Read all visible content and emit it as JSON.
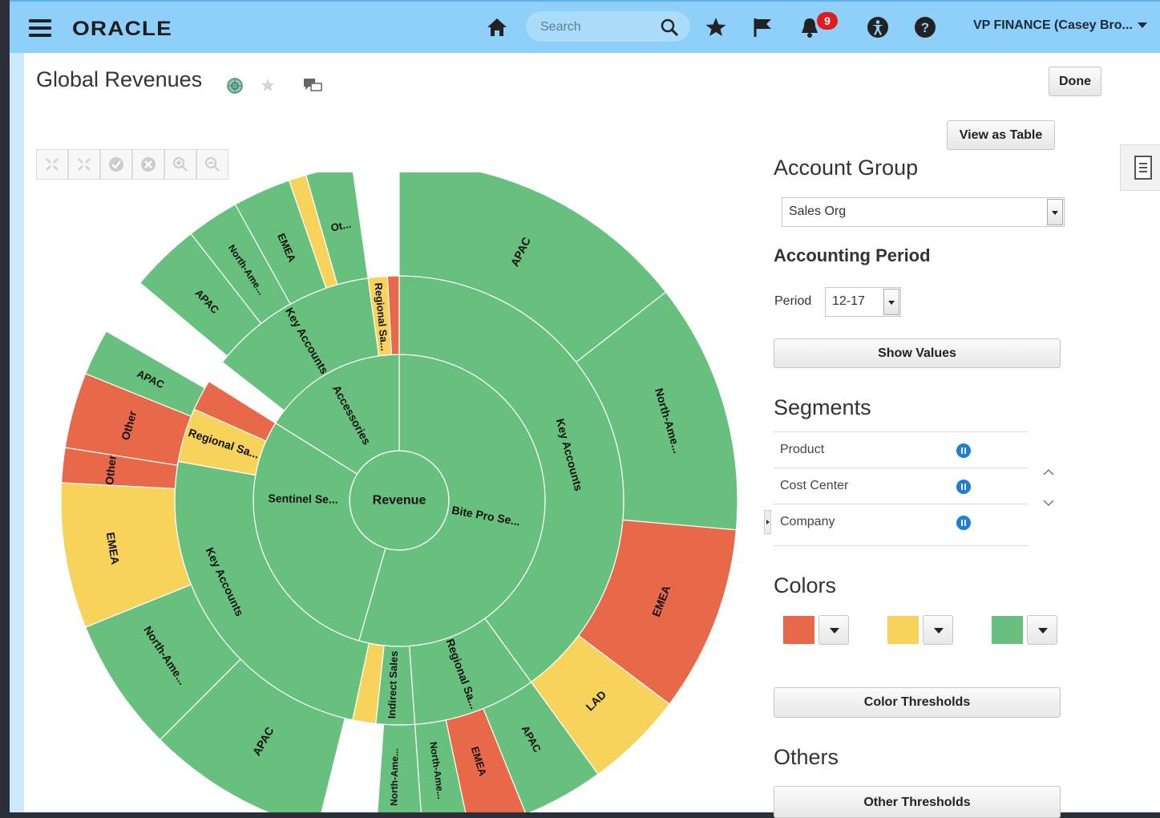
{
  "header": {
    "brand": "ORACLE",
    "search_placeholder": "Search",
    "notification_count": "9",
    "user_menu": "VP FINANCE (Casey Bro..."
  },
  "page": {
    "title": "Global Revenues",
    "done_label": "Done",
    "view_as_table_label": "View as Table"
  },
  "panel": {
    "account_group_title": "Account Group",
    "account_group_value": "Sales Org",
    "accounting_period_title": "Accounting Period",
    "period_label": "Period",
    "period_value": "12-17",
    "show_values_label": "Show Values",
    "segments_title": "Segments",
    "segments": [
      "Product",
      "Cost Center",
      "Company"
    ],
    "colors_title": "Colors",
    "colors": [
      "#e8684a",
      "#f7d35c",
      "#68c07e"
    ],
    "color_thresholds_label": "Color Thresholds",
    "others_title": "Others",
    "other_thresholds_label": "Other Thresholds"
  },
  "chart_data": {
    "type": "sunburst",
    "center_label": "Revenue",
    "rings": {
      "products": [
        "Accessories",
        "Bite Pro Se...",
        "Sentinel Se..."
      ],
      "cost_centers": [
        "Key Accounts",
        "Regional Sa...",
        "Key Accounts",
        "Regional Sa...",
        "Indirect Sales",
        "Key Accounts",
        "Regional Sa..."
      ],
      "companies": [
        "APAC",
        "North-Ame...",
        "EMEA",
        "Ot...",
        "APAC",
        "North-Ame...",
        "EMEA",
        "LAD",
        "APAC",
        "EMEA",
        "North-Ame...",
        "North-Ame...",
        "APAC",
        "North-Ame...",
        "EMEA",
        "Other",
        "Other",
        "APAC"
      ]
    }
  }
}
